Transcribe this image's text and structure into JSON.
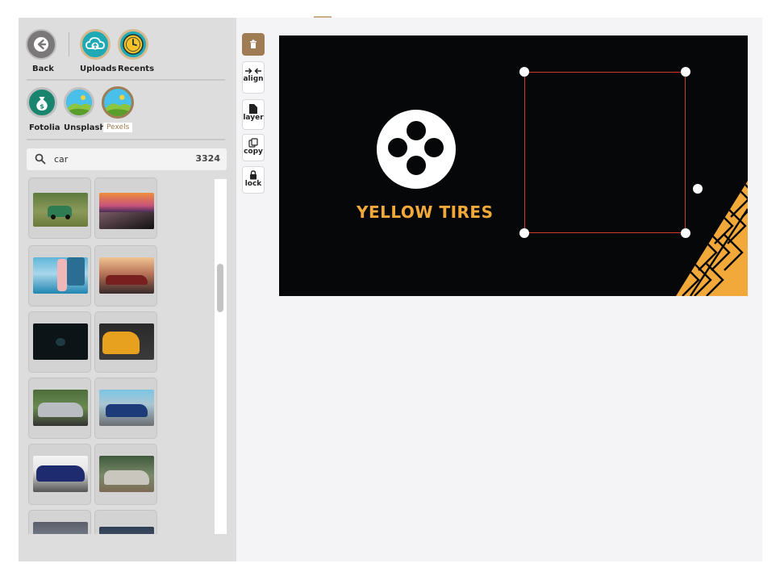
{
  "sidebar": {
    "nav": {
      "back_label": "Back",
      "uploads_label": "Uploads",
      "recents_label": "Recents"
    },
    "sources": {
      "fotolia_label": "Fotolia",
      "unsplash_label": "Unsplash",
      "pexels_label": "Pexels",
      "active": "Pexels"
    },
    "search": {
      "value": "car",
      "result_count": "3324"
    },
    "thumbnails": [
      "green-mini-car",
      "road-sunset",
      "woman-car-door",
      "red-classic-car",
      "dark-car-interior",
      "yellow-audi",
      "silver-mercedes",
      "rally-car",
      "blue-audi",
      "rusty-old-car",
      "car-partial-1",
      "car-partial-2"
    ]
  },
  "toolbar": {
    "delete_icon": "trash-icon",
    "align_label": "align",
    "layer_label": "layer",
    "copy_label": "copy",
    "lock_label": "lock"
  },
  "canvas": {
    "brand_text": "YELLOW TIRES",
    "background": "#050708",
    "accent": "#f3a93a"
  },
  "colors": {
    "sidebar_bg": "#dcdddc",
    "brown_accent": "#a07c54",
    "teal": "#1fa9b5",
    "selection": "#cc3a2a"
  }
}
